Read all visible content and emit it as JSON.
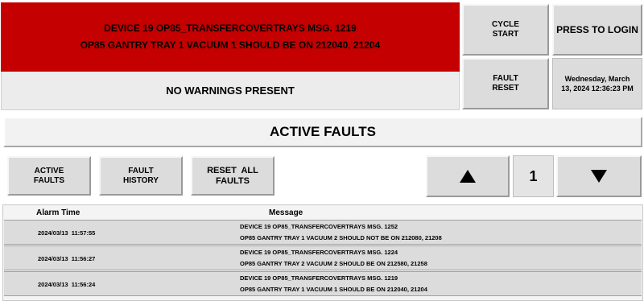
{
  "header": {
    "alarm_line1": "DEVICE 19 OP85_TRANSFERCOVERTRAYS MSG. 1219",
    "alarm_line2": "OP85 GANTRY TRAY 1 VACUUM 1 SHOULD BE ON 212040, 21204",
    "warning_text": "NO WARNINGS PRESENT",
    "alarm_color": "#c40000"
  },
  "controls": {
    "cycle_start_line1": "CYCLE",
    "cycle_start_line2": "START",
    "press_to_login": "PRESS TO LOGIN",
    "fault_reset_line1": "FAULT",
    "fault_reset_line2": "RESET",
    "clock_line1": "Wednesday, March",
    "clock_line2": "13, 2024 12:36:23 PM"
  },
  "title": "ACTIVE FAULTS",
  "nav": {
    "active_faults_line1": "ACTIVE",
    "active_faults_line2": "FAULTS",
    "fault_history_line1": "FAULT",
    "fault_history_line2": "HISTORY",
    "reset_all_line1": "RESET  ALL",
    "reset_all_line2": "FAULTS",
    "up_icon": "triangle-up",
    "down_icon": "triangle-down",
    "page_number": "1"
  },
  "table": {
    "columns": [
      "Alarm Time",
      "Message"
    ],
    "rows": [
      {
        "time": "2024/03/13  11:57:55",
        "line1": "DEVICE 19 OP85_TRANSFERCOVERTRAYS MSG. 1252",
        "line2": "OP85 GANTRY TRAY 1 VACUUM 2 SHOULD NOT BE ON 212080, 21208"
      },
      {
        "time": "2024/03/13  11:56:27",
        "line1": "DEVICE 19 OP85_TRANSFERCOVERTRAYS MSG. 1224",
        "line2": "OP85 GANTRY TRAY 2 VACUUM 2 SHOULD BE ON 212580, 21258"
      },
      {
        "time": "2024/03/13  11:56:24",
        "line1": "DEVICE 19 OP85_TRANSFERCOVERTRAYS MSG. 1219",
        "line2": "OP85 GANTRY TRAY 1 VACUUM 1 SHOULD BE ON 212040, 21204"
      }
    ]
  }
}
